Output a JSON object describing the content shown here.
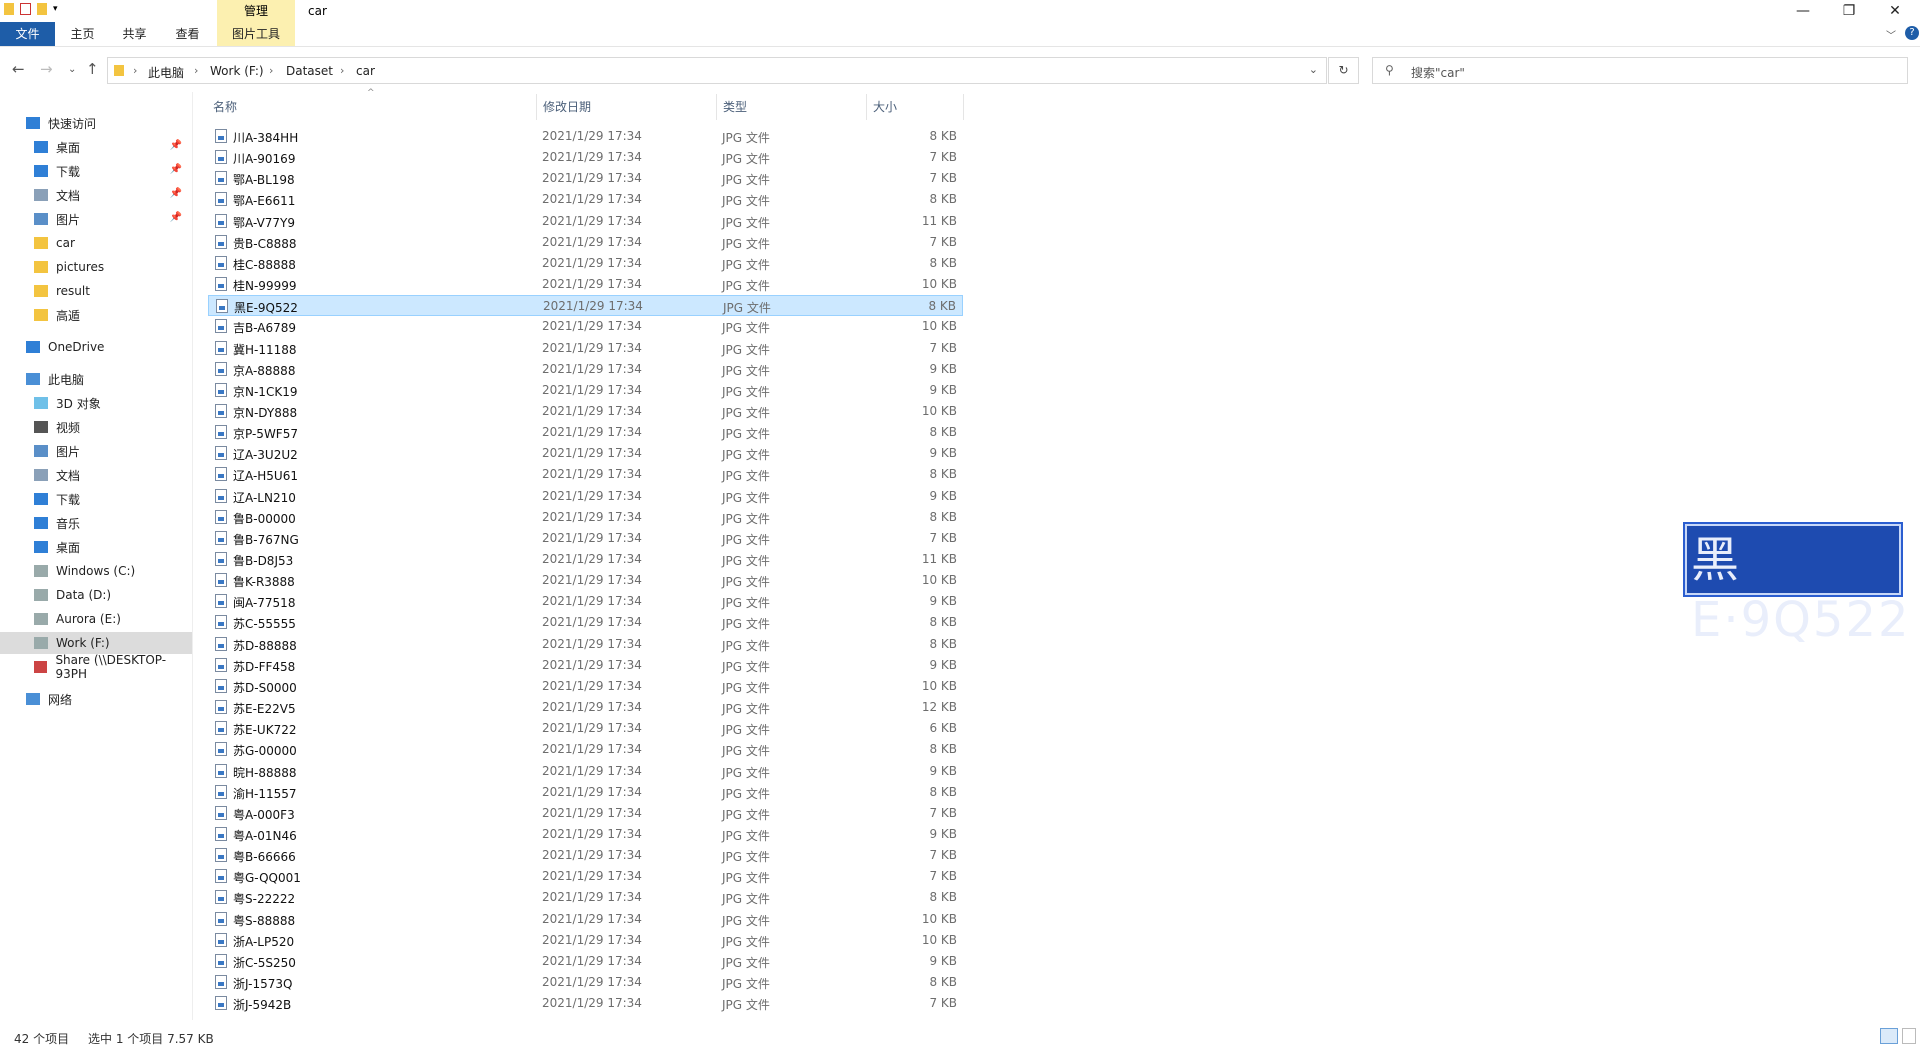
{
  "window": {
    "title": "car",
    "context_tab": "管理",
    "minimize": "—",
    "restore": "❐",
    "close": "✕"
  },
  "ribbon": {
    "tabs": [
      "文件",
      "主页",
      "共享",
      "查看",
      "图片工具"
    ]
  },
  "address": {
    "crumbs": [
      "此电脑",
      "Work (F:)",
      "Dataset",
      "car"
    ],
    "search_placeholder": "搜索\"car\""
  },
  "nav": {
    "quick_access": "快速访问",
    "quick_items": [
      {
        "label": "桌面",
        "icon": "desktop-icon",
        "pinned": true
      },
      {
        "label": "下载",
        "icon": "download-icon",
        "pinned": true
      },
      {
        "label": "文档",
        "icon": "document-icon",
        "pinned": true
      },
      {
        "label": "图片",
        "icon": "picture-icon",
        "pinned": true
      },
      {
        "label": "car",
        "icon": "folder-icon",
        "pinned": false
      },
      {
        "label": "pictures",
        "icon": "folder-icon",
        "pinned": false
      },
      {
        "label": "result",
        "icon": "folder-icon",
        "pinned": false
      },
      {
        "label": "高遁",
        "icon": "folder-icon",
        "pinned": false
      }
    ],
    "onedrive": "OneDrive",
    "this_pc": "此电脑",
    "pc_items": [
      {
        "label": "3D 对象",
        "icon": "3d-objects-icon"
      },
      {
        "label": "视频",
        "icon": "video-icon"
      },
      {
        "label": "图片",
        "icon": "picture-icon"
      },
      {
        "label": "文档",
        "icon": "document-icon"
      },
      {
        "label": "下载",
        "icon": "download-icon"
      },
      {
        "label": "音乐",
        "icon": "music-icon"
      },
      {
        "label": "桌面",
        "icon": "desktop-icon"
      },
      {
        "label": "Windows (C:)",
        "icon": "drive-icon"
      },
      {
        "label": "Data (D:)",
        "icon": "drive-icon"
      },
      {
        "label": "Aurora (E:)",
        "icon": "drive-icon"
      },
      {
        "label": "Work (F:)",
        "icon": "drive-icon",
        "selected": true
      },
      {
        "label": "Share (\\\\DESKTOP-93PH",
        "icon": "network-drive-icon"
      }
    ],
    "network": "网络"
  },
  "columns": {
    "name": "名称",
    "date": "修改日期",
    "type": "类型",
    "size": "大小"
  },
  "files": [
    {
      "name": "川A-384HH",
      "date": "2021/1/29 17:34",
      "type": "JPG 文件",
      "size": "8 KB"
    },
    {
      "name": "川A-90169",
      "date": "2021/1/29 17:34",
      "type": "JPG 文件",
      "size": "7 KB"
    },
    {
      "name": "鄂A-BL198",
      "date": "2021/1/29 17:34",
      "type": "JPG 文件",
      "size": "7 KB"
    },
    {
      "name": "鄂A-E6611",
      "date": "2021/1/29 17:34",
      "type": "JPG 文件",
      "size": "8 KB"
    },
    {
      "name": "鄂A-V77Y9",
      "date": "2021/1/29 17:34",
      "type": "JPG 文件",
      "size": "11 KB"
    },
    {
      "name": "贵B-C8888",
      "date": "2021/1/29 17:34",
      "type": "JPG 文件",
      "size": "7 KB"
    },
    {
      "name": "桂C-88888",
      "date": "2021/1/29 17:34",
      "type": "JPG 文件",
      "size": "8 KB"
    },
    {
      "name": "桂N-99999",
      "date": "2021/1/29 17:34",
      "type": "JPG 文件",
      "size": "10 KB"
    },
    {
      "name": "黑E-9Q522",
      "date": "2021/1/29 17:34",
      "type": "JPG 文件",
      "size": "8 KB",
      "selected": true
    },
    {
      "name": "吉B-A6789",
      "date": "2021/1/29 17:34",
      "type": "JPG 文件",
      "size": "10 KB"
    },
    {
      "name": "冀H-11188",
      "date": "2021/1/29 17:34",
      "type": "JPG 文件",
      "size": "7 KB"
    },
    {
      "name": "京A-88888",
      "date": "2021/1/29 17:34",
      "type": "JPG 文件",
      "size": "9 KB"
    },
    {
      "name": "京N-1CK19",
      "date": "2021/1/29 17:34",
      "type": "JPG 文件",
      "size": "9 KB"
    },
    {
      "name": "京N-DY888",
      "date": "2021/1/29 17:34",
      "type": "JPG 文件",
      "size": "10 KB"
    },
    {
      "name": "京P-5WF57",
      "date": "2021/1/29 17:34",
      "type": "JPG 文件",
      "size": "8 KB"
    },
    {
      "name": "辽A-3U2U2",
      "date": "2021/1/29 17:34",
      "type": "JPG 文件",
      "size": "9 KB"
    },
    {
      "name": "辽A-H5U61",
      "date": "2021/1/29 17:34",
      "type": "JPG 文件",
      "size": "8 KB"
    },
    {
      "name": "辽A-LN210",
      "date": "2021/1/29 17:34",
      "type": "JPG 文件",
      "size": "9 KB"
    },
    {
      "name": "鲁B-00000",
      "date": "2021/1/29 17:34",
      "type": "JPG 文件",
      "size": "8 KB"
    },
    {
      "name": "鲁B-767NG",
      "date": "2021/1/29 17:34",
      "type": "JPG 文件",
      "size": "7 KB"
    },
    {
      "name": "鲁B-D8J53",
      "date": "2021/1/29 17:34",
      "type": "JPG 文件",
      "size": "11 KB"
    },
    {
      "name": "鲁K-R3888",
      "date": "2021/1/29 17:34",
      "type": "JPG 文件",
      "size": "10 KB"
    },
    {
      "name": "闽A-77518",
      "date": "2021/1/29 17:34",
      "type": "JPG 文件",
      "size": "9 KB"
    },
    {
      "name": "苏C-55555",
      "date": "2021/1/29 17:34",
      "type": "JPG 文件",
      "size": "8 KB"
    },
    {
      "name": "苏D-88888",
      "date": "2021/1/29 17:34",
      "type": "JPG 文件",
      "size": "8 KB"
    },
    {
      "name": "苏D-FF458",
      "date": "2021/1/29 17:34",
      "type": "JPG 文件",
      "size": "9 KB"
    },
    {
      "name": "苏D-S0000",
      "date": "2021/1/29 17:34",
      "type": "JPG 文件",
      "size": "10 KB"
    },
    {
      "name": "苏E-E22V5",
      "date": "2021/1/29 17:34",
      "type": "JPG 文件",
      "size": "12 KB"
    },
    {
      "name": "苏E-UK722",
      "date": "2021/1/29 17:34",
      "type": "JPG 文件",
      "size": "6 KB"
    },
    {
      "name": "苏G-00000",
      "date": "2021/1/29 17:34",
      "type": "JPG 文件",
      "size": "8 KB"
    },
    {
      "name": "晥H-88888",
      "date": "2021/1/29 17:34",
      "type": "JPG 文件",
      "size": "9 KB"
    },
    {
      "name": "渝H-11557",
      "date": "2021/1/29 17:34",
      "type": "JPG 文件",
      "size": "8 KB"
    },
    {
      "name": "粤A-000F3",
      "date": "2021/1/29 17:34",
      "type": "JPG 文件",
      "size": "7 KB"
    },
    {
      "name": "粤A-01N46",
      "date": "2021/1/29 17:34",
      "type": "JPG 文件",
      "size": "9 KB"
    },
    {
      "name": "粤B-66666",
      "date": "2021/1/29 17:34",
      "type": "JPG 文件",
      "size": "7 KB"
    },
    {
      "name": "粤G-QQ001",
      "date": "2021/1/29 17:34",
      "type": "JPG 文件",
      "size": "7 KB"
    },
    {
      "name": "粤S-22222",
      "date": "2021/1/29 17:34",
      "type": "JPG 文件",
      "size": "8 KB"
    },
    {
      "name": "粤S-88888",
      "date": "2021/1/29 17:34",
      "type": "JPG 文件",
      "size": "10 KB"
    },
    {
      "name": "浙A-LP520",
      "date": "2021/1/29 17:34",
      "type": "JPG 文件",
      "size": "10 KB"
    },
    {
      "name": "浙C-5S250",
      "date": "2021/1/29 17:34",
      "type": "JPG 文件",
      "size": "9 KB"
    },
    {
      "name": "浙J-1573Q",
      "date": "2021/1/29 17:34",
      "type": "JPG 文件",
      "size": "8 KB"
    },
    {
      "name": "浙J-5942B",
      "date": "2021/1/29 17:34",
      "type": "JPG 文件",
      "size": "7 KB"
    }
  ],
  "preview": {
    "plate_text": "黑E·9Q522",
    "bg_color": "#1e4bb0"
  },
  "status": {
    "item_count": "42 个项目",
    "selection": "选中 1 个项目  7.57 KB"
  },
  "colors": {
    "file_tab": "#1e5da8",
    "tool_tab": "#fcf0b0",
    "selection_bg": "#cce8ff",
    "selection_border": "#99d1ff"
  }
}
